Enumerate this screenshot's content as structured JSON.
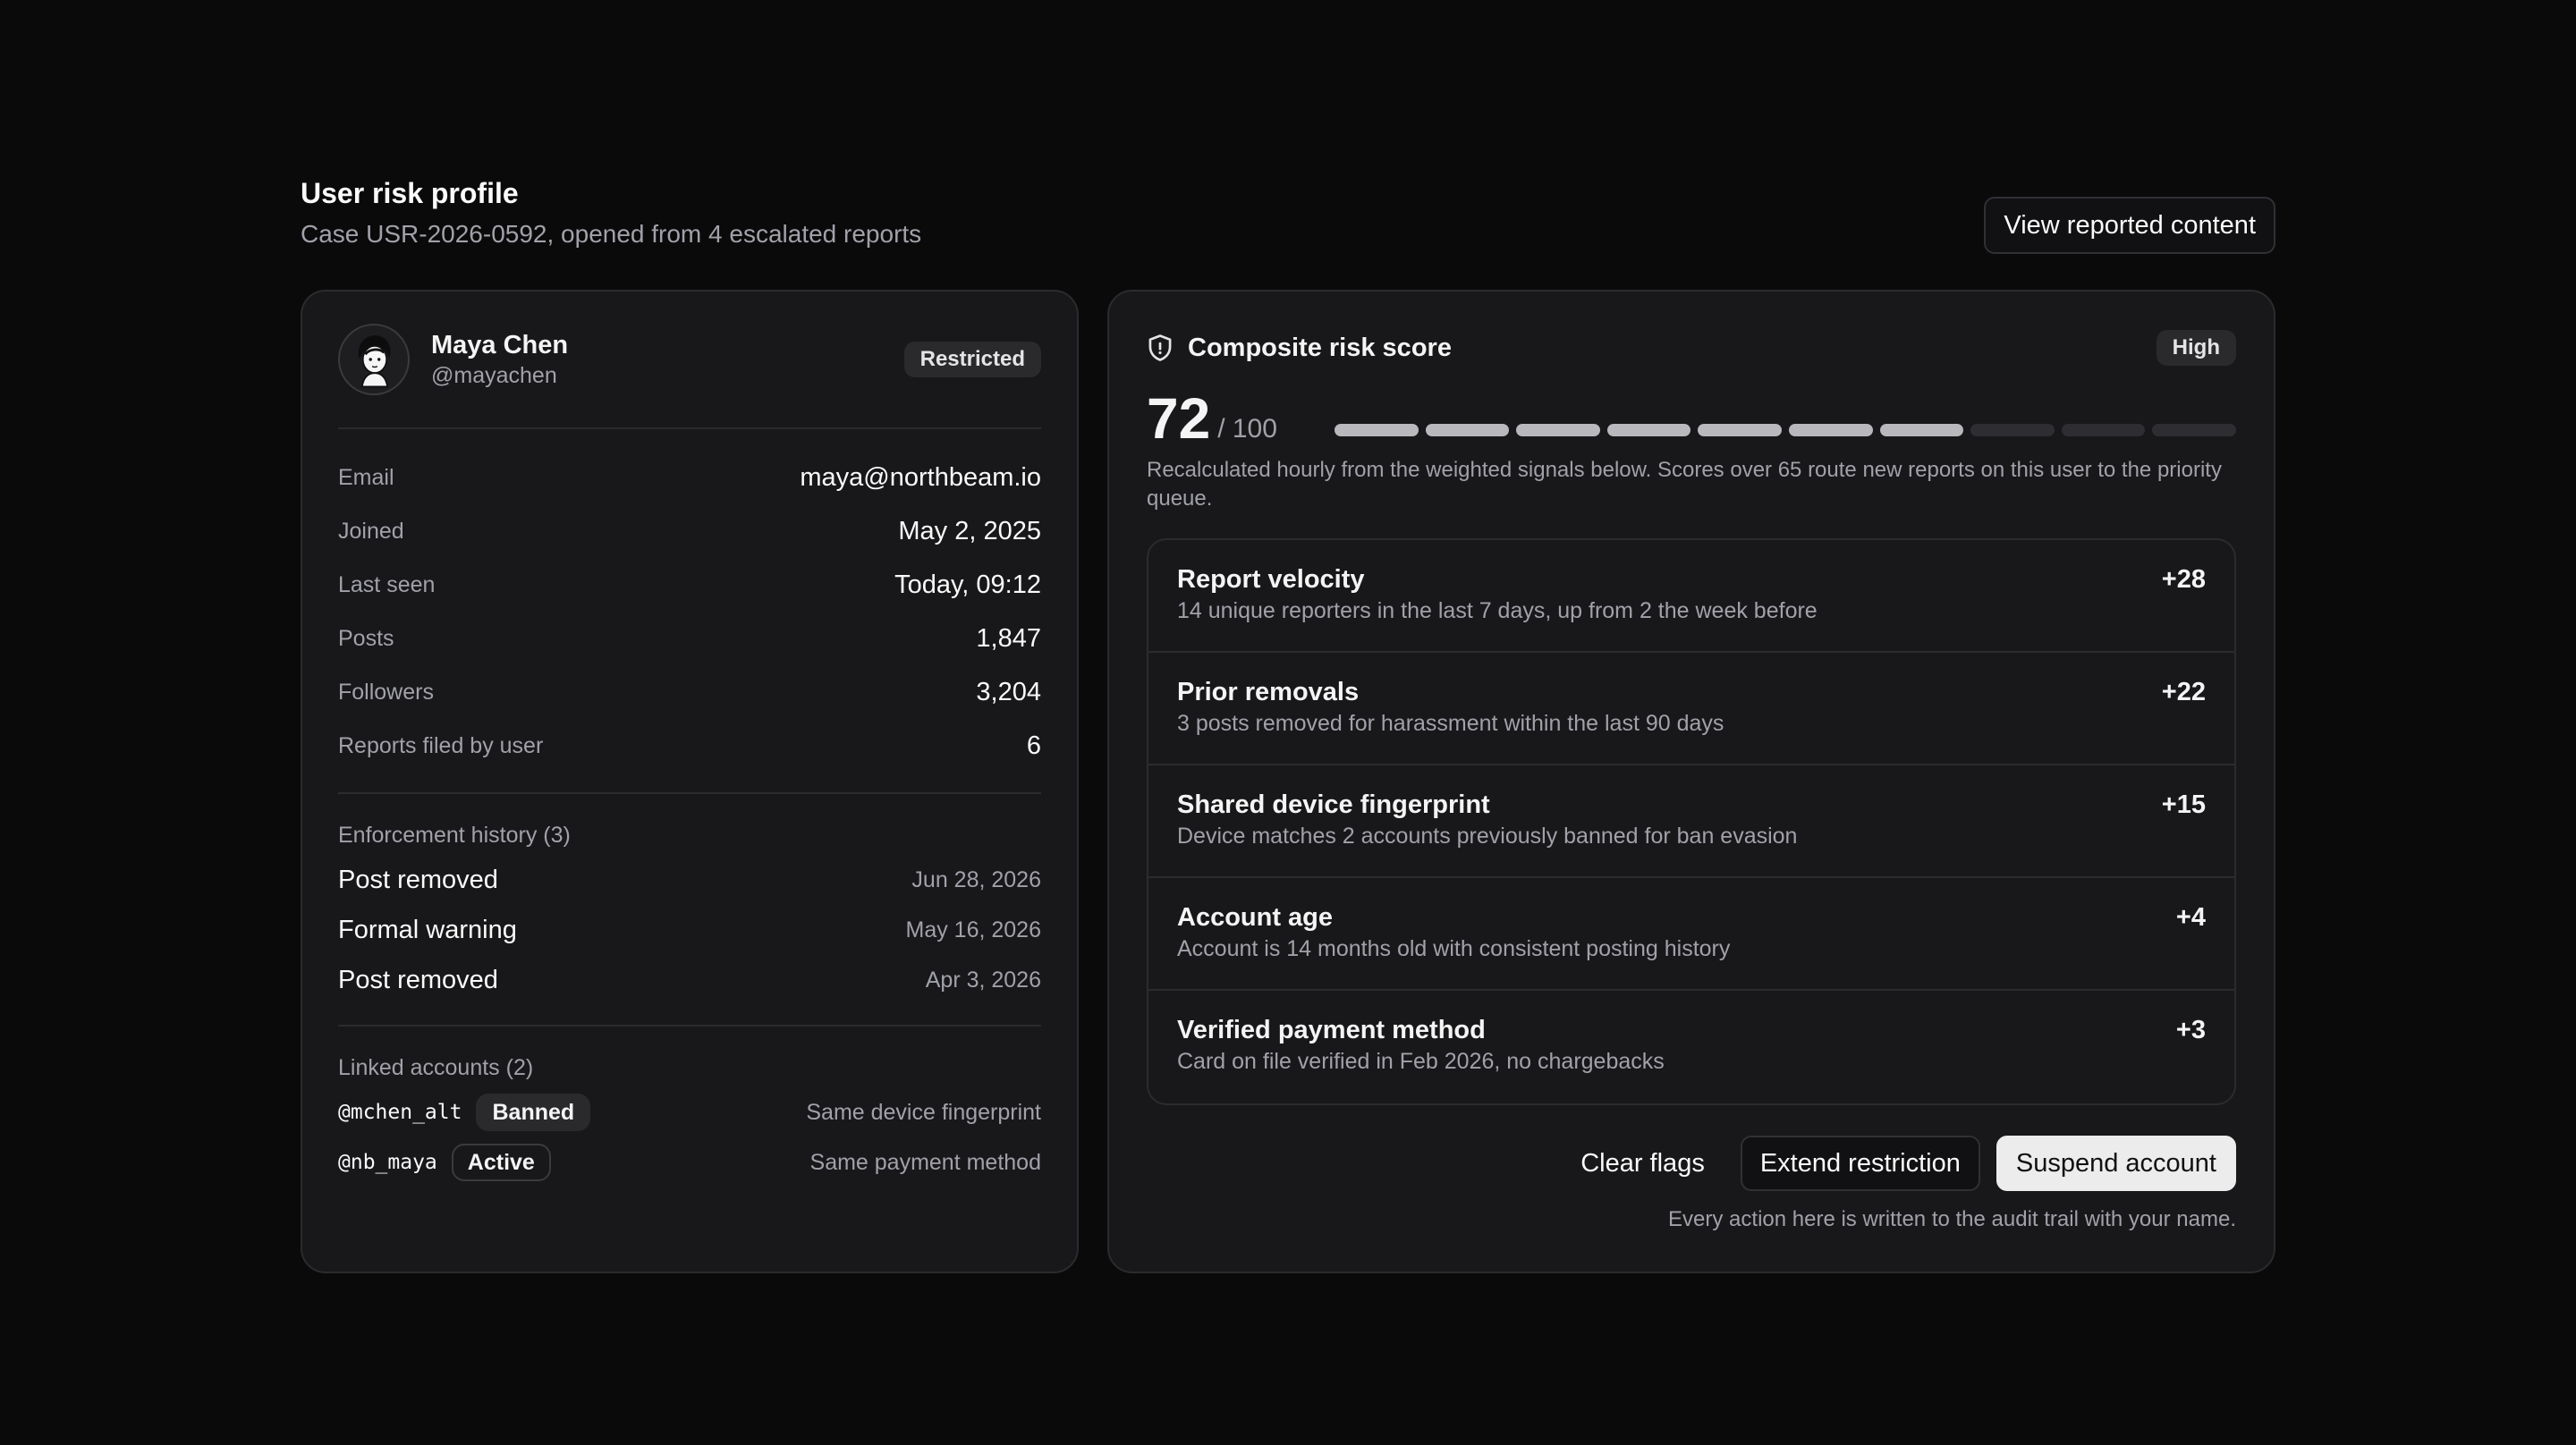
{
  "header": {
    "title": "User risk profile",
    "subtitle": "Case USR-2026-0592, opened from 4 escalated reports",
    "view_button": "View reported content"
  },
  "user": {
    "name": "Maya Chen",
    "handle": "@mayachen",
    "status": "Restricted",
    "details": [
      {
        "label": "Email",
        "value": "maya@northbeam.io"
      },
      {
        "label": "Joined",
        "value": "May 2, 2025"
      },
      {
        "label": "Last seen",
        "value": "Today, 09:12"
      },
      {
        "label": "Posts",
        "value": "1,847"
      },
      {
        "label": "Followers",
        "value": "3,204"
      },
      {
        "label": "Reports filed by user",
        "value": "6"
      }
    ]
  },
  "enforcement": {
    "title": "Enforcement history (3)",
    "items": [
      {
        "action": "Post removed",
        "date": "Jun 28, 2026"
      },
      {
        "action": "Formal warning",
        "date": "May 16, 2026"
      },
      {
        "action": "Post removed",
        "date": "Apr 3, 2026"
      }
    ]
  },
  "linked": {
    "title": "Linked accounts (2)",
    "items": [
      {
        "handle": "@mchen_alt",
        "status": "Banned",
        "reason": "Same device fingerprint"
      },
      {
        "handle": "@nb_maya",
        "status": "Active",
        "reason": "Same payment method"
      }
    ]
  },
  "risk": {
    "title": "Composite risk score",
    "level": "High",
    "score": "72",
    "max": "/ 100",
    "score_fraction": 0.72,
    "segments_total": 10,
    "segments_filled": 7,
    "description": "Recalculated hourly from the weighted signals below. Scores over 65 route new reports on this user to the priority queue.",
    "signals": [
      {
        "name": "Report velocity",
        "detail": "14 unique reporters in the last 7 days, up from 2 the week before",
        "delta": "+28"
      },
      {
        "name": "Prior removals",
        "detail": "3 posts removed for harassment within the last 90 days",
        "delta": "+22"
      },
      {
        "name": "Shared device fingerprint",
        "detail": "Device matches 2 accounts previously banned for ban evasion",
        "delta": "+15"
      },
      {
        "name": "Account age",
        "detail": "Account is 14 months old with consistent posting history",
        "delta": "+4"
      },
      {
        "name": "Verified payment method",
        "detail": "Card on file verified in Feb 2026, no chargebacks",
        "delta": "+3"
      }
    ]
  },
  "actions": {
    "clear": "Clear flags",
    "extend": "Extend restriction",
    "suspend": "Suspend account",
    "audit_note": "Every action here is written to the audit trail with your name."
  },
  "icons": {
    "avatar": "avatar-illustration",
    "risk": "shield-icon"
  }
}
